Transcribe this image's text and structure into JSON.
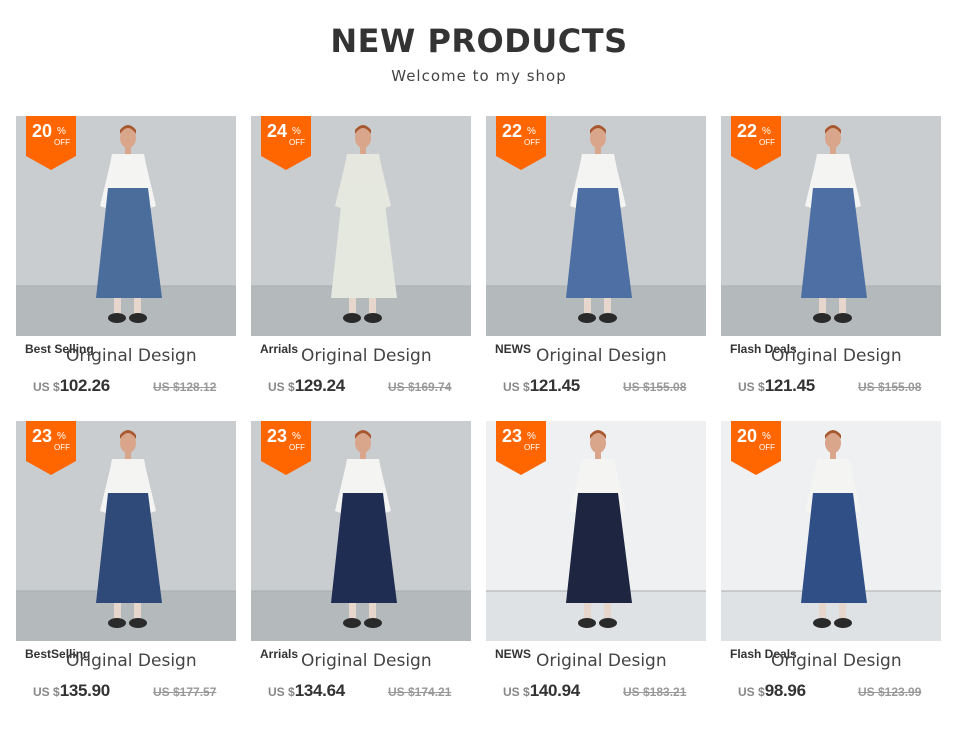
{
  "header": {
    "title": "NEW PRODUCTS",
    "subtitle": "Welcome to my shop"
  },
  "colors": {
    "badge": "#ff6600",
    "title": "#333333",
    "old_price": "#999999"
  },
  "products": [
    {
      "discount": "20",
      "percent_sign": "%",
      "off": "OFF",
      "tag": "Best Selling",
      "name": "Original Design",
      "currency": "US $",
      "price": "102.26",
      "old_price": "US $128.12",
      "image_icon": "model-photo",
      "dress_color": "#4a6d9c"
    },
    {
      "discount": "24",
      "percent_sign": "%",
      "off": "OFF",
      "tag": "Arrials",
      "name": "Original Design",
      "currency": "US $",
      "price": "129.24",
      "old_price": "US $169.74",
      "image_icon": "model-photo",
      "dress_color": "#e4e8df"
    },
    {
      "discount": "22",
      "percent_sign": "%",
      "off": "OFF",
      "tag": "NEWS",
      "name": "Original Design",
      "currency": "US $",
      "price": "121.45",
      "old_price": "US $155.08",
      "image_icon": "model-photo",
      "dress_color": "#4d6fa3"
    },
    {
      "discount": "22",
      "percent_sign": "%",
      "off": "OFF",
      "tag": "Flash Deals",
      "name": "Original Design",
      "currency": "US $",
      "price": "121.45",
      "old_price": "US $155.08",
      "image_icon": "model-photo",
      "dress_color": "#4d6fa3"
    },
    {
      "discount": "23",
      "percent_sign": "%",
      "off": "OFF",
      "tag": "BestSelling",
      "name": "Original Design",
      "currency": "US $",
      "price": "135.90",
      "old_price": "US $177.57",
      "image_icon": "model-photo",
      "dress_color": "#2f4a78"
    },
    {
      "discount": "23",
      "percent_sign": "%",
      "off": "OFF",
      "tag": "Arrials",
      "name": "Original Design",
      "currency": "US $",
      "price": "134.64",
      "old_price": "US $174.21",
      "image_icon": "model-photo",
      "dress_color": "#1f2d52"
    },
    {
      "discount": "23",
      "percent_sign": "%",
      "off": "OFF",
      "tag": "NEWS",
      "name": "Original Design",
      "currency": "US $",
      "price": "140.94",
      "old_price": "US $183.21",
      "image_icon": "model-photo",
      "dress_color": "#1d2540"
    },
    {
      "discount": "20",
      "percent_sign": "%",
      "off": "OFF",
      "tag": "Flash Deals",
      "name": "Original Design",
      "currency": "US $",
      "price": "98.96",
      "old_price": "US $123.99",
      "image_icon": "model-photo",
      "dress_color": "#2f4f86"
    }
  ]
}
